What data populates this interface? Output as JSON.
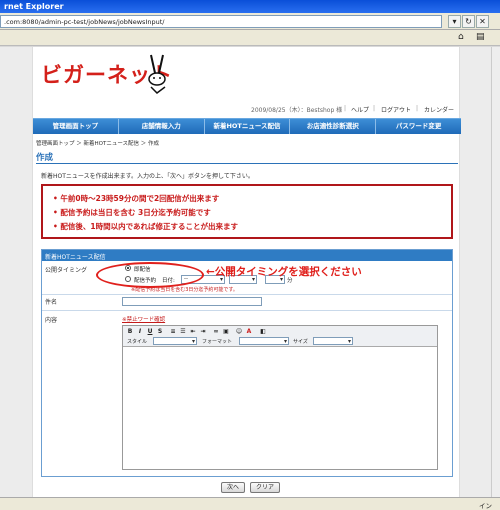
{
  "browser": {
    "title": "rnet Explorer",
    "address": ".com:8080/admin-pc-test/jobNews/jobNewsInput/",
    "status_right": "イン"
  },
  "site": {
    "logo_text": "ビガーネット",
    "user_line": "2009/08/25（木）：Bestshop 様",
    "top_links": [
      "ヘルプ",
      "ログアウト",
      "カレンダー"
    ]
  },
  "nav": [
    "管理画面トップ",
    "店舗情報入力",
    "新着HOTニュース配信",
    "お店適性診断選択",
    "パスワード変更"
  ],
  "breadcrumb": "管理画面トップ ＞ 新着HOTニュース配信 ＞ 作成",
  "page_title": "作成",
  "intro": "新着HOTニュースを作成出来ます。入力の上、「次へ」ボタンを押して下さい。",
  "notice": [
    "午前0時〜23時59分の間で2回配信が出来ます",
    "配信予約は当日を含む 3日分迄予約可能です",
    "配信後、1時間以内であれば修正することが出来ます"
  ],
  "form": {
    "header": "新着HOTニュース配信",
    "timing_label": "公開タイミング",
    "option_immediate": "即配信",
    "option_scheduled": "配信予約",
    "date_label": "日付:",
    "date_value": "--",
    "minute_label": "分",
    "hint": "※配信予約は当日を含む3日分迄予約可能です。",
    "callout": "←公開タイミングを選択ください",
    "subject_label": "件名",
    "body_label": "内容",
    "banned_words_link": "※禁止ワード確認",
    "editor": {
      "style_label": "スタイル",
      "format_label": "フォーマット",
      "size_label": "サイズ"
    },
    "next_button": "次へ",
    "clear_button": "クリア"
  }
}
